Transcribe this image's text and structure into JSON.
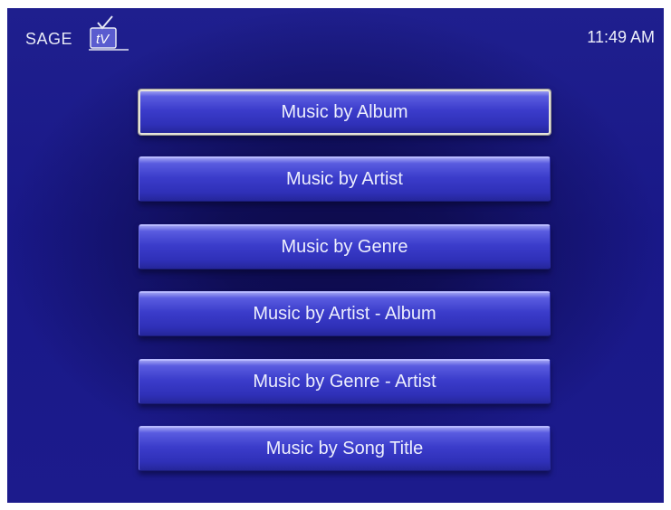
{
  "header": {
    "logo_text": "SAGE",
    "logo_mark": "tV",
    "clock": "11:49 AM"
  },
  "menu": {
    "items": [
      {
        "label": "Music by Album",
        "selected": true
      },
      {
        "label": "Music by Artist",
        "selected": false
      },
      {
        "label": "Music by Genre",
        "selected": false
      },
      {
        "label": "Music by Artist - Album",
        "selected": false
      },
      {
        "label": "Music by Genre - Artist",
        "selected": false
      },
      {
        "label": "Music by Song Title",
        "selected": false
      }
    ]
  },
  "colors": {
    "background": "#1c1b8c",
    "button": "#3b3ccb",
    "selected_border": "#e6e4da",
    "text": "#eceefd"
  }
}
